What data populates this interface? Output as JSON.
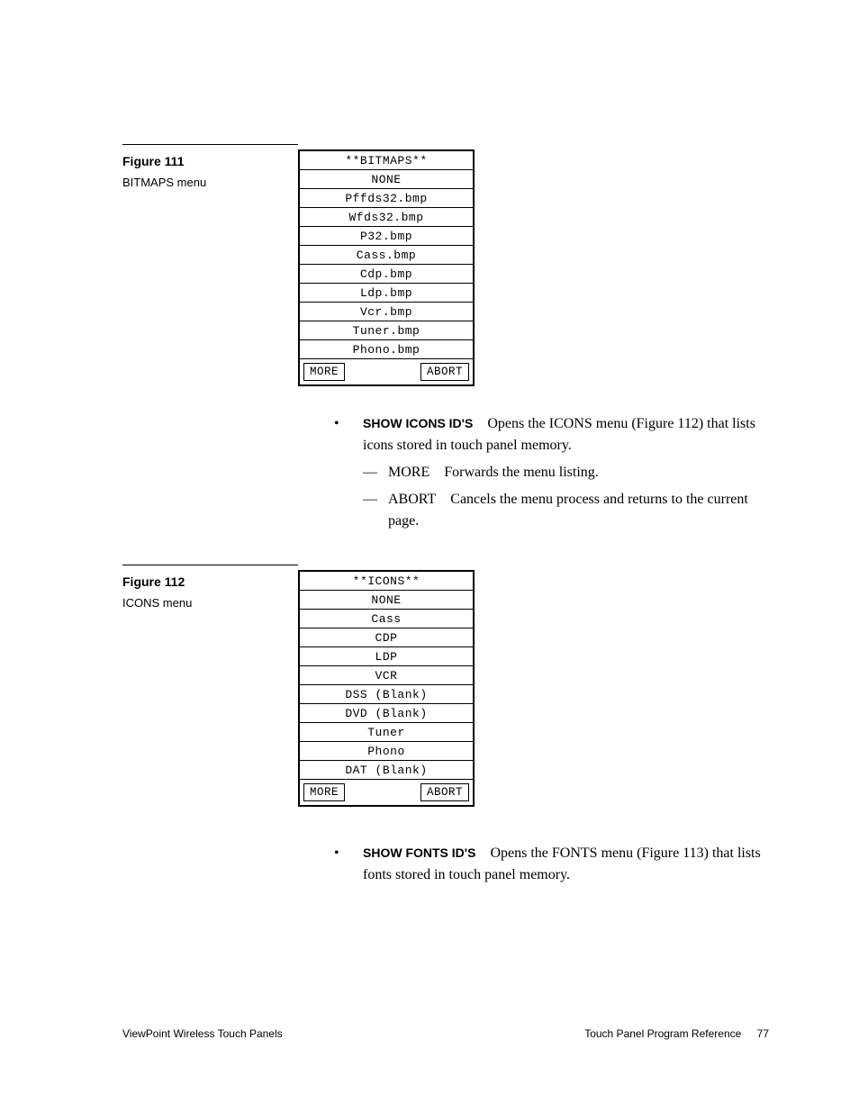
{
  "figure111": {
    "label": "Figure 111",
    "caption": "BITMAPS menu",
    "title": "**BITMAPS**",
    "rows": [
      "NONE",
      "Pffds32.bmp",
      "Wfds32.bmp",
      "P32.bmp",
      "Cass.bmp",
      "Cdp.bmp",
      "Ldp.bmp",
      "Vcr.bmp",
      "Tuner.bmp",
      "Phono.bmp"
    ],
    "more": "MORE",
    "abort": "ABORT"
  },
  "bulletBlock1": {
    "lead": "SHOW ICONS ID'S",
    "rest": "Opens the ICONS menu (Figure 112) that lists icons stored in touch panel memory.",
    "sub1_lead": "MORE",
    "sub1_rest": "Forwards the menu listing.",
    "sub2_lead": "ABORT",
    "sub2_rest": "Cancels the menu process and returns to the current page."
  },
  "figure112": {
    "label": "Figure 112",
    "caption": "ICONS menu",
    "title": "**ICONS**",
    "rows": [
      "NONE",
      "Cass",
      "CDP",
      "LDP",
      "VCR",
      "DSS (Blank)",
      "DVD (Blank)",
      "Tuner",
      "Phono",
      "DAT (Blank)"
    ],
    "more": "MORE",
    "abort": "ABORT"
  },
  "bulletBlock2": {
    "lead": "SHOW FONTS ID'S",
    "rest": "Opens the FONTS menu (Figure 113) that lists fonts stored in touch panel memory."
  },
  "footer": {
    "left": "ViewPoint Wireless Touch Panels",
    "right": "Touch Panel Program Reference",
    "page": "77"
  }
}
